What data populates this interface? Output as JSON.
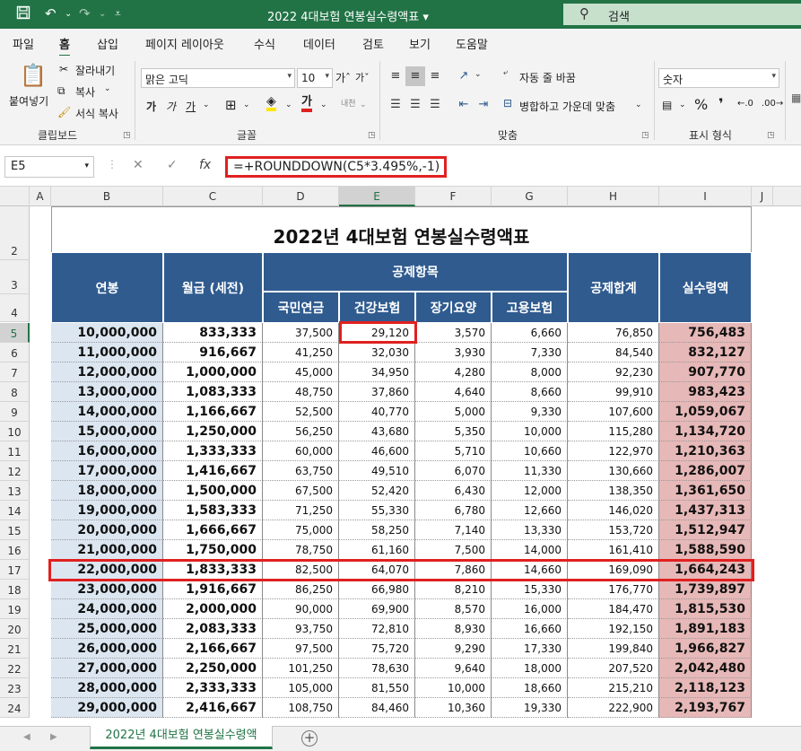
{
  "titlebar": {
    "doc_title": "2022 4대보험 연봉실수령액표 ▾",
    "search_label": "검색",
    "save_icon": "save-icon",
    "undo_icon": "undo-icon",
    "redo_icon": "redo-icon"
  },
  "tabs": [
    "파일",
    "홈",
    "삽입",
    "페이지 레이아웃",
    "수식",
    "데이터",
    "검토",
    "보기",
    "도움말"
  ],
  "ribbon": {
    "clipboard": {
      "paste": "붙여넣기",
      "cut": "잘라내기",
      "copy": "복사",
      "format_painter": "서식 복사",
      "group": "클립보드"
    },
    "font": {
      "name": "맑은 고딕",
      "size": "10",
      "bold": "가",
      "italic": "가",
      "underline": "가",
      "group": "글꼴"
    },
    "align": {
      "wrap": "자동 줄 바꿈",
      "merge": "병합하고 가운데 맞춤",
      "group": "맞춤"
    },
    "number": {
      "format": "숫자",
      "group": "표시 형식"
    }
  },
  "formula_bar": {
    "name_box": "E5",
    "formula": "=+ROUNDDOWN(C5*3.495%,-1)",
    "fx": "fx",
    "cancel": "✕",
    "confirm": "✓"
  },
  "columns": [
    "A",
    "B",
    "C",
    "D",
    "E",
    "F",
    "G",
    "H",
    "I",
    "J"
  ],
  "sheet": {
    "title": "2022년 4대보험 연봉실수령액표",
    "headers": {
      "annual": "연봉",
      "monthly": "월급 (세전)",
      "deductions": "공제항목",
      "pension": "국민연금",
      "health": "건강보험",
      "ltc": "장기요양",
      "employment": "고용보험",
      "total": "공제합계",
      "net": "실수령액"
    },
    "rows": [
      {
        "n": "5",
        "a": "10,000,000",
        "m": "833,333",
        "p": "37,500",
        "h": "29,120",
        "l": "3,570",
        "e": "6,660",
        "t": "76,850",
        "net": "756,483"
      },
      {
        "n": "6",
        "a": "11,000,000",
        "m": "916,667",
        "p": "41,250",
        "h": "32,030",
        "l": "3,930",
        "e": "7,330",
        "t": "84,540",
        "net": "832,127"
      },
      {
        "n": "7",
        "a": "12,000,000",
        "m": "1,000,000",
        "p": "45,000",
        "h": "34,950",
        "l": "4,280",
        "e": "8,000",
        "t": "92,230",
        "net": "907,770"
      },
      {
        "n": "8",
        "a": "13,000,000",
        "m": "1,083,333",
        "p": "48,750",
        "h": "37,860",
        "l": "4,640",
        "e": "8,660",
        "t": "99,910",
        "net": "983,423"
      },
      {
        "n": "9",
        "a": "14,000,000",
        "m": "1,166,667",
        "p": "52,500",
        "h": "40,770",
        "l": "5,000",
        "e": "9,330",
        "t": "107,600",
        "net": "1,059,067"
      },
      {
        "n": "10",
        "a": "15,000,000",
        "m": "1,250,000",
        "p": "56,250",
        "h": "43,680",
        "l": "5,350",
        "e": "10,000",
        "t": "115,280",
        "net": "1,134,720"
      },
      {
        "n": "11",
        "a": "16,000,000",
        "m": "1,333,333",
        "p": "60,000",
        "h": "46,600",
        "l": "5,710",
        "e": "10,660",
        "t": "122,970",
        "net": "1,210,363"
      },
      {
        "n": "12",
        "a": "17,000,000",
        "m": "1,416,667",
        "p": "63,750",
        "h": "49,510",
        "l": "6,070",
        "e": "11,330",
        "t": "130,660",
        "net": "1,286,007"
      },
      {
        "n": "13",
        "a": "18,000,000",
        "m": "1,500,000",
        "p": "67,500",
        "h": "52,420",
        "l": "6,430",
        "e": "12,000",
        "t": "138,350",
        "net": "1,361,650"
      },
      {
        "n": "14",
        "a": "19,000,000",
        "m": "1,583,333",
        "p": "71,250",
        "h": "55,330",
        "l": "6,780",
        "e": "12,660",
        "t": "146,020",
        "net": "1,437,313"
      },
      {
        "n": "15",
        "a": "20,000,000",
        "m": "1,666,667",
        "p": "75,000",
        "h": "58,250",
        "l": "7,140",
        "e": "13,330",
        "t": "153,720",
        "net": "1,512,947"
      },
      {
        "n": "16",
        "a": "21,000,000",
        "m": "1,750,000",
        "p": "78,750",
        "h": "61,160",
        "l": "7,500",
        "e": "14,000",
        "t": "161,410",
        "net": "1,588,590"
      },
      {
        "n": "17",
        "a": "22,000,000",
        "m": "1,833,333",
        "p": "82,500",
        "h": "64,070",
        "l": "7,860",
        "e": "14,660",
        "t": "169,090",
        "net": "1,664,243"
      },
      {
        "n": "18",
        "a": "23,000,000",
        "m": "1,916,667",
        "p": "86,250",
        "h": "66,980",
        "l": "8,210",
        "e": "15,330",
        "t": "176,770",
        "net": "1,739,897"
      },
      {
        "n": "19",
        "a": "24,000,000",
        "m": "2,000,000",
        "p": "90,000",
        "h": "69,900",
        "l": "8,570",
        "e": "16,000",
        "t": "184,470",
        "net": "1,815,530"
      },
      {
        "n": "20",
        "a": "25,000,000",
        "m": "2,083,333",
        "p": "93,750",
        "h": "72,810",
        "l": "8,930",
        "e": "16,660",
        "t": "192,150",
        "net": "1,891,183"
      },
      {
        "n": "21",
        "a": "26,000,000",
        "m": "2,166,667",
        "p": "97,500",
        "h": "75,720",
        "l": "9,290",
        "e": "17,330",
        "t": "199,840",
        "net": "1,966,827"
      },
      {
        "n": "22",
        "a": "27,000,000",
        "m": "2,250,000",
        "p": "101,250",
        "h": "78,630",
        "l": "9,640",
        "e": "18,000",
        "t": "207,520",
        "net": "2,042,480"
      },
      {
        "n": "23",
        "a": "28,000,000",
        "m": "2,333,333",
        "p": "105,000",
        "h": "81,550",
        "l": "10,000",
        "e": "18,660",
        "t": "215,210",
        "net": "2,118,123"
      },
      {
        "n": "24",
        "a": "29,000,000",
        "m": "2,416,667",
        "p": "108,750",
        "h": "84,460",
        "l": "10,360",
        "e": "19,330",
        "t": "222,900",
        "net": "2,193,767"
      }
    ]
  },
  "sheet_tab": {
    "label": "2022년 4대보험 연봉실수령액",
    "add": "+"
  },
  "colors": {
    "header_blue": "#2f5b8f",
    "annual_bg": "#dce6f1",
    "net_bg": "#e6b8b7",
    "highlight": "#e02020",
    "excel_green": "#217346"
  }
}
